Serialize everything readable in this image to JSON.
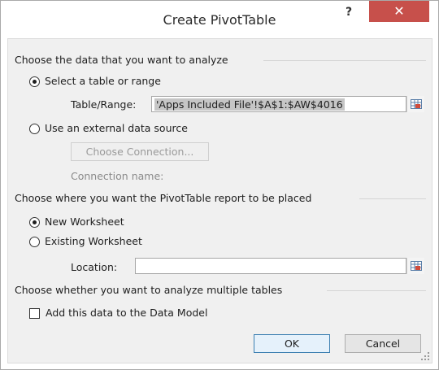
{
  "window": {
    "title": "Create PivotTable",
    "help_label": "?",
    "close_label": "✕"
  },
  "analyze_section": {
    "heading": "Choose the data that you want to analyze",
    "select_table_label": "Select a table or range",
    "table_range_label": "Table/Range:",
    "table_range_value": "'Apps Included File'!$A$1:$AW$4016",
    "external_source_label": "Use an external data source",
    "choose_connection_label": "Choose Connection...",
    "connection_name_label": "Connection name:"
  },
  "placement_section": {
    "heading": "Choose where you want the PivotTable report to be placed",
    "new_worksheet_label": "New Worksheet",
    "existing_worksheet_label": "Existing Worksheet",
    "location_label": "Location:",
    "location_value": ""
  },
  "multiple_tables_section": {
    "heading": "Choose whether you want to analyze multiple tables",
    "data_model_label": "Add this data to the Data Model",
    "data_model_checked": false
  },
  "buttons": {
    "ok_label": "OK",
    "cancel_label": "Cancel"
  },
  "icons": {
    "help": "help-icon",
    "close": "close-icon",
    "range_selector": "range-selector-icon",
    "resize_grip": "resize-grip-icon"
  },
  "colors": {
    "close_button": "#c7504b",
    "ok_border": "#3c7fb1",
    "client_bg": "#f0f0f0"
  }
}
